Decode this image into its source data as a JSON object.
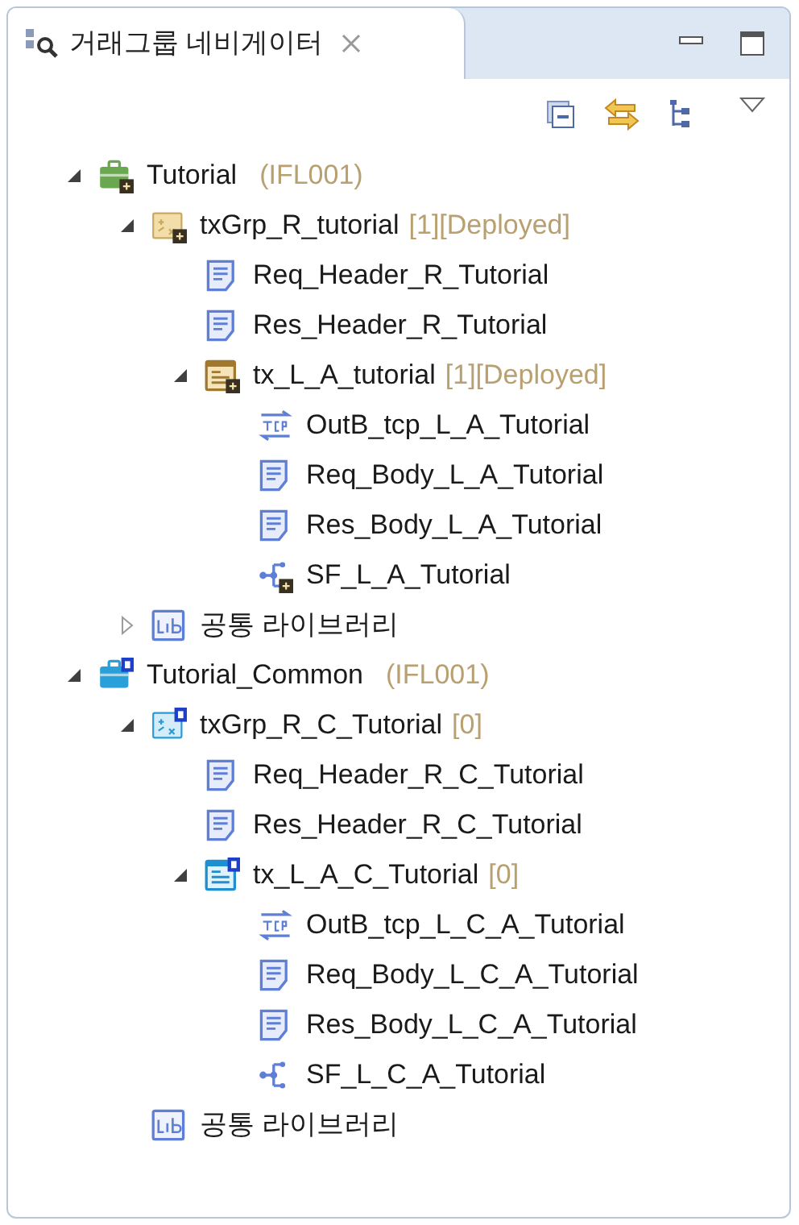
{
  "view": {
    "title": "거래그룹 네비게이터"
  },
  "tree": [
    {
      "kind": "project",
      "label": "Tutorial",
      "meta": "(IFL001)",
      "expanded": true,
      "children": [
        {
          "kind": "group",
          "label": "txGrp_R_tutorial",
          "meta": "[1][Deployed]",
          "expanded": true,
          "children": [
            {
              "kind": "message",
              "label": "Req_Header_R_Tutorial"
            },
            {
              "kind": "message",
              "label": "Res_Header_R_Tutorial"
            },
            {
              "kind": "tx",
              "label": "tx_L_A_tutorial",
              "meta": "[1][Deployed]",
              "expanded": true,
              "children": [
                {
                  "kind": "tcp",
                  "label": "OutB_tcp_L_A_Tutorial"
                },
                {
                  "kind": "message",
                  "label": "Req_Body_L_A_Tutorial"
                },
                {
                  "kind": "message",
                  "label": "Res_Body_L_A_Tutorial"
                },
                {
                  "kind": "flow",
                  "label": "SF_L_A_Tutorial"
                }
              ]
            }
          ]
        },
        {
          "kind": "library",
          "label": "공통 라이브러리",
          "expanded": false
        }
      ]
    },
    {
      "kind": "common-project",
      "label": "Tutorial_Common",
      "meta": "(IFL001)",
      "expanded": true,
      "children": [
        {
          "kind": "common-group",
          "label": "txGrp_R_C_Tutorial",
          "meta": "[0]",
          "expanded": true,
          "children": [
            {
              "kind": "message",
              "label": "Req_Header_R_C_Tutorial"
            },
            {
              "kind": "message",
              "label": "Res_Header_R_C_Tutorial"
            },
            {
              "kind": "common-tx",
              "label": "tx_L_A_C_Tutorial",
              "meta": "[0]",
              "expanded": true,
              "children": [
                {
                  "kind": "tcp",
                  "label": "OutB_tcp_L_C_A_Tutorial"
                },
                {
                  "kind": "message",
                  "label": "Req_Body_L_C_A_Tutorial"
                },
                {
                  "kind": "message",
                  "label": "Res_Body_L_C_A_Tutorial"
                },
                {
                  "kind": "flow",
                  "label": "SF_L_C_A_Tutorial"
                }
              ]
            }
          ]
        },
        {
          "kind": "library",
          "label": "공통 라이브러리"
        }
      ]
    }
  ]
}
